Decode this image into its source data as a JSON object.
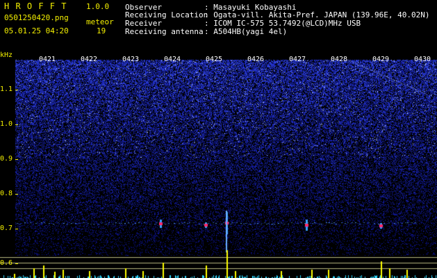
{
  "app": {
    "title": "H R O F F T",
    "version": "1.0.0",
    "filename": "0501250420.png",
    "datetime": "05.01.25 04:20",
    "meteor_label": "meteor",
    "meteor_count": "19"
  },
  "info": {
    "rows": [
      {
        "label": "Observer",
        "value": ": Masayuki Kobayashi"
      },
      {
        "label": "Receiving Location",
        "value": ": Ogata-vill. Akita-Pref. JAPAN (139.96E, 40.02N)"
      },
      {
        "label": "Receiver",
        "value": ": ICOM IC-575 53.7492(@LCD)MHz USB"
      },
      {
        "label": "Receiving antenna",
        "value": ": A504HB(yagi 4el)"
      }
    ]
  },
  "freq_axis": {
    "unit": "kHz",
    "labels": [
      "1.1",
      "1.0",
      "0.9",
      "0.8",
      "0.7",
      "0.6"
    ]
  },
  "time_axis": {
    "labels": [
      "0421",
      "0422",
      "0423",
      "0424",
      "0425",
      "0426",
      "0427",
      "0428",
      "0429",
      "0430"
    ]
  },
  "colors": {
    "background": "#000000",
    "accent": "#f4f000",
    "text": "#ffffff",
    "noise_base": "#0a0f6a",
    "meteor": "#ff2a6a"
  }
}
